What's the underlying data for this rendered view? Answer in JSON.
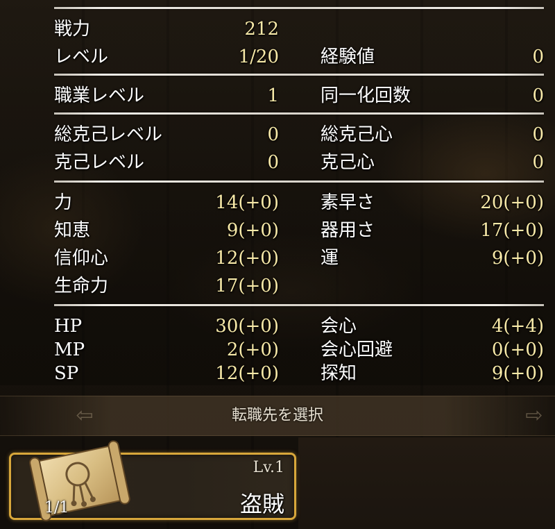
{
  "stats": {
    "battle_power": {
      "label": "戦力",
      "value": "212"
    },
    "level": {
      "label": "レベル",
      "value": "1/20"
    },
    "exp": {
      "label": "経験値",
      "value": "0"
    },
    "job_level": {
      "label": "職業レベル",
      "value": "1"
    },
    "unify_count": {
      "label": "同一化回数",
      "value": "0"
    },
    "total_overcome_level": {
      "label": "総克己レベル",
      "value": "0"
    },
    "total_overcome_heart": {
      "label": "総克己心",
      "value": "0"
    },
    "overcome_level": {
      "label": "克己レベル",
      "value": "0"
    },
    "overcome_heart": {
      "label": "克己心",
      "value": "0"
    },
    "str": {
      "label": "力",
      "value": "14(+0)"
    },
    "agi": {
      "label": "素早さ",
      "value": "20(+0)"
    },
    "int": {
      "label": "知恵",
      "value": "9(+0)"
    },
    "dex": {
      "label": "器用さ",
      "value": "17(+0)"
    },
    "faith": {
      "label": "信仰心",
      "value": "12(+0)"
    },
    "luck": {
      "label": "運",
      "value": "9(+0)"
    },
    "vit": {
      "label": "生命力",
      "value": "17(+0)"
    },
    "hp": {
      "label": "HP",
      "value": "30(+0)"
    },
    "crit": {
      "label": "会心",
      "value": "4(+4)"
    },
    "mp": {
      "label": "MP",
      "value": "2(+0)"
    },
    "crit_evade": {
      "label": "会心回避",
      "value": "0(+0)"
    },
    "sp": {
      "label": "SP",
      "value": "12(+0)"
    },
    "detect": {
      "label": "探知",
      "value": "9(+0)"
    }
  },
  "select_bar": {
    "label": "転職先を選択",
    "left_arrow_icon": "arrow-left-icon",
    "right_arrow_icon": "arrow-right-icon"
  },
  "job_card": {
    "count": "1/1",
    "level": "Lv.1",
    "name": "盗賊",
    "icon": "scroll-icon"
  },
  "colors": {
    "value_text": "#f7e9a8",
    "label_text": "#ffffff",
    "card_border": "#d8a73b"
  }
}
